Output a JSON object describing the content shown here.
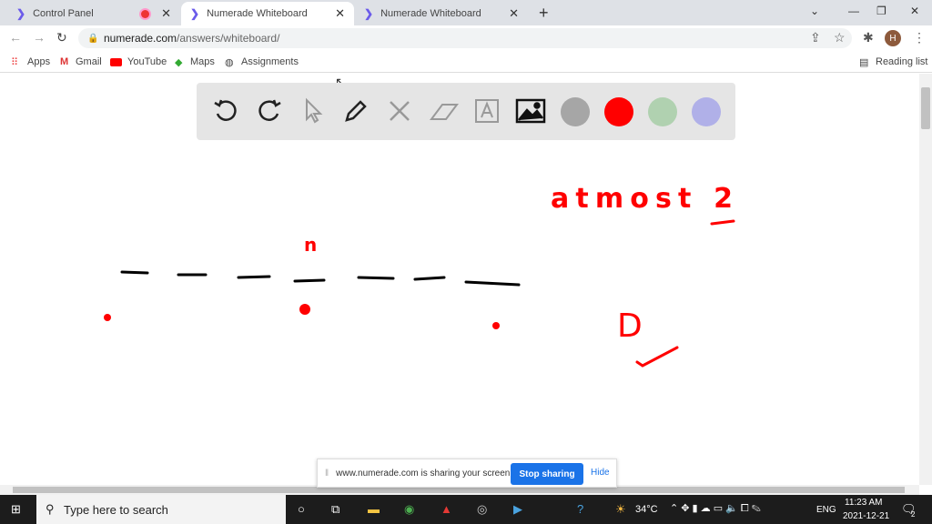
{
  "tabs": [
    {
      "title": "Control Panel"
    },
    {
      "title": "Numerade Whiteboard"
    },
    {
      "title": "Numerade Whiteboard"
    }
  ],
  "address": {
    "host": "numerade.com",
    "path": "/answers/whiteboard/"
  },
  "bookmarks": [
    "Apps",
    "Gmail",
    "YouTube",
    "Maps",
    "Assignments"
  ],
  "reading_list": "Reading list",
  "toolbar": {
    "tools": [
      "undo-icon",
      "redo-icon",
      "select-icon",
      "pen-icon",
      "tools-icon",
      "eraser-icon",
      "text-icon",
      "image-icon"
    ],
    "colors": [
      "#a6a6a6",
      "#ff0000",
      "#b0d1b0",
      "#b0b0e8"
    ]
  },
  "handwriting": {
    "note": "atmost 2",
    "letter": "D",
    "mark": "n"
  },
  "share_bar": {
    "message": "www.numerade.com is sharing your screen.",
    "stop": "Stop sharing",
    "hide": "Hide"
  },
  "taskbar": {
    "search_placeholder": "Type here to search",
    "temp": "34°C",
    "lang": "ENG",
    "time": "11:23 AM",
    "date": "2021-12-21",
    "notifications": "2"
  }
}
